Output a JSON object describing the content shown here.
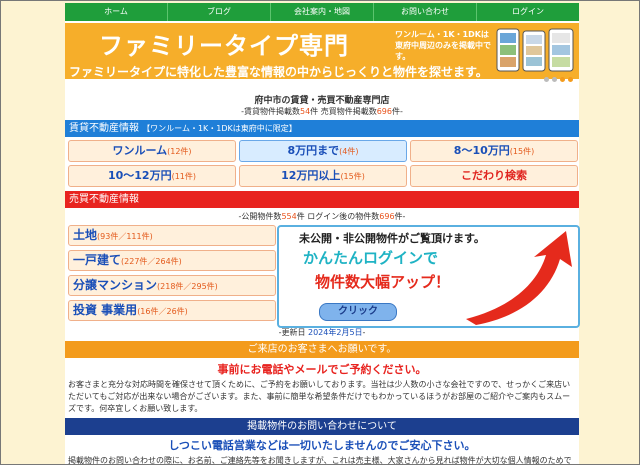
{
  "nav": [
    "ホーム",
    "ブログ",
    "会社案内・地図",
    "お問い合わせ",
    "ログイン"
  ],
  "banner": {
    "title": "ファミリータイプ専門",
    "note_line1": "ワンルーム・1K・1DKは",
    "note_line2": "東府中周辺のみを掲載中です。",
    "subtitle": "ファミリータイプに特化した豊富な情報の中からじっくりと物件を探せます。"
  },
  "company": {
    "name": "府中市の賃貸・売買不動産専門店",
    "counts_prefix": "-賃貸物件掲載数",
    "rent_count": "54",
    "counts_mid": "件 売買物件掲載数",
    "sale_count": "696",
    "counts_suffix": "件-"
  },
  "rental": {
    "header": "賃貸不動産情報",
    "header_note": "【ワンルーム・1K・1DKは東府中に限定】",
    "buttons": [
      {
        "label": "ワンルーム",
        "count": "(12件)"
      },
      {
        "label": "8万円まで",
        "count": "(4件)"
      },
      {
        "label": "8～10万円",
        "count": "(15件)"
      },
      {
        "label": "10～12万円",
        "count": "(11件)"
      },
      {
        "label": "12万円以上",
        "count": "(15件)"
      },
      {
        "label": "こだわり検索",
        "count": ""
      }
    ]
  },
  "sale": {
    "header": "売買不動産情報",
    "counts_prefix": "-公開物件数",
    "public_count": "554",
    "counts_mid": "件 ログイン後の物件数",
    "login_count": "696",
    "counts_suffix": "件-",
    "items": [
      {
        "label": "土地",
        "count": "(93件／111件)"
      },
      {
        "label": "一戸建て",
        "count": "(227件／264件)"
      },
      {
        "label": "分譲マンション",
        "count": "(218件／295件)"
      },
      {
        "label": "投資 事業用",
        "count": "(16件／26件)"
      }
    ],
    "ad": {
      "line1": "未公開・非公開物件がご覧頂けます。",
      "line2": "かんたんログインで",
      "line3": "物件数大幅アップ！",
      "button": "クリック"
    }
  },
  "update": {
    "prefix": "-更新日 ",
    "date": "2024年2月5日",
    "suffix": "-"
  },
  "notice": {
    "header": "ご来店のお客さまへお願いです。",
    "headline": "事前にお電話やメールでご予約ください。",
    "body": "お客さまと充分な対応時間を確保させて頂くために、ご予約をお願いしております。当社は少人数の小さな会社ですので、せっかくご来店いただいてもご対応が出来ない場合がございます。また、事前に簡単な希望条件だけでもわかっているほうがお部屋のご紹介やご案内もスムーズです。何卒宜しくお願い致します。"
  },
  "inquiry": {
    "header": "掲載物件のお問い合わせについて",
    "headline": "しつこい電話営業などは一切いたしませんのでご安心下さい。",
    "body": "掲載物件のお問い合わせの際に、お名前、ご連絡先等をお聞きしますが、これは売主様、大家さんから見れば物件が大切な個人情報のためです。しつこい電話営業行為などは一切いたしませんのでご安心下さい。"
  },
  "colors": {
    "nav": "#1f9e3b",
    "banner": "#f6ae2a",
    "rent_header": "#1f7fd8",
    "sale_header": "#e8231f",
    "notice_header": "#f39b1c",
    "inquiry_header": "#1c3f8f"
  }
}
